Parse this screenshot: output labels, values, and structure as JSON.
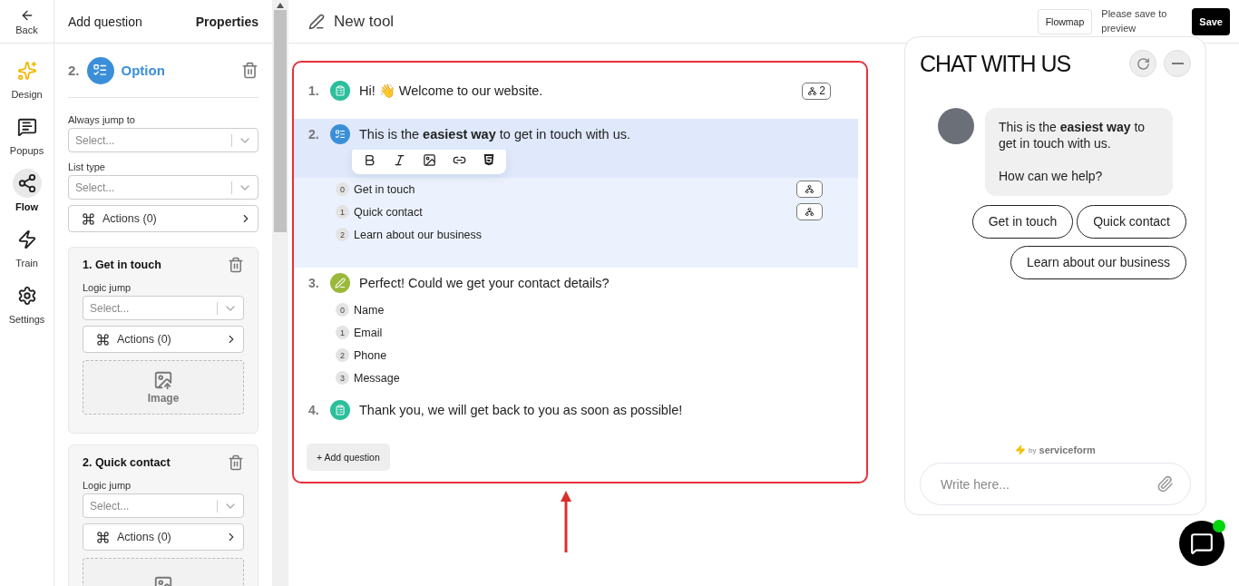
{
  "nav": {
    "back": "Back",
    "items": [
      {
        "label": "Design",
        "selected": false
      },
      {
        "label": "Popups",
        "selected": false
      },
      {
        "label": "Flow",
        "selected": true
      },
      {
        "label": "Train",
        "selected": false
      },
      {
        "label": "Settings",
        "selected": false
      }
    ]
  },
  "panel": {
    "tabs": [
      {
        "label": "Add question",
        "selected": false
      },
      {
        "label": "Properties",
        "selected": true
      }
    ],
    "question": {
      "number": "2.",
      "kind": "option",
      "type": "Option"
    },
    "fields": [
      {
        "label": "Always jump to",
        "placeholder": "Select..."
      },
      {
        "label": "List type",
        "placeholder": "Select..."
      }
    ],
    "actions": "Actions (0)",
    "options": [
      {
        "title": "1. Get in touch",
        "logic_label": "Logic jump",
        "placeholder": "Select...",
        "actions": "Actions (0)",
        "image_label": "Image"
      },
      {
        "title": "2. Quick contact",
        "logic_label": "Logic jump",
        "placeholder": "Select...",
        "actions": "Actions (0)"
      }
    ]
  },
  "header": {
    "title": "New tool",
    "flowmap": "Flowmap",
    "save_note": "Please save to preview",
    "save": "Save"
  },
  "questions": [
    {
      "number": "1.",
      "kind": "message",
      "text": "Hi! 👋 Welcome to our website.",
      "badge": "2",
      "selected": false
    },
    {
      "number": "2.",
      "kind": "option",
      "text": "This is the **easiest way** to get in touch with us.",
      "selected": true,
      "options": [
        {
          "index": "0",
          "label": "Get in touch",
          "jump": true
        },
        {
          "index": "1",
          "label": "Quick contact",
          "jump": true
        },
        {
          "index": "2",
          "label": "Learn about our business",
          "jump": false
        }
      ]
    },
    {
      "number": "3.",
      "kind": "input",
      "text": "Perfect! Could we get your contact details?",
      "selected": false,
      "options": [
        {
          "index": "0",
          "label": "Name",
          "jump": false
        },
        {
          "index": "1",
          "label": "Email",
          "jump": false
        },
        {
          "index": "2",
          "label": "Phone",
          "jump": false
        },
        {
          "index": "3",
          "label": "Message",
          "jump": false
        }
      ]
    },
    {
      "number": "4.",
      "kind": "message",
      "text": "Thank you, we will get back to you as soon as possible!",
      "selected": false
    }
  ],
  "add_question": "+ Add question",
  "chat": {
    "title": "CHAT WITH US",
    "bubble": [
      "This is the **easiest way** to get in touch with us.",
      "How can we help?"
    ],
    "replies": [
      "Get in touch",
      "Quick contact",
      "Learn about our business"
    ],
    "branding_by": "by",
    "branding": "serviceform",
    "input_placeholder": "Write here...",
    "launcher_online": true
  }
}
